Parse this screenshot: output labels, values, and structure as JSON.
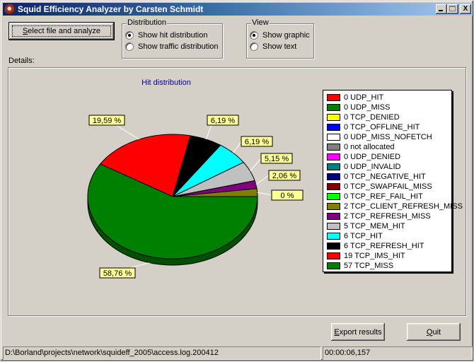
{
  "window": {
    "title": "Squid Efficiency Analyzer by Carsten Schmidt",
    "minimize_label": "_",
    "maximize_label": "□",
    "close_label": "X"
  },
  "toolbar": {
    "select_button": {
      "prefix": "S",
      "rest": "elect file and analyze"
    }
  },
  "distribution": {
    "label": "Distribution",
    "options": [
      {
        "label": "Show hit distribution",
        "checked": true
      },
      {
        "label": "Show traffic distribution",
        "checked": false
      }
    ]
  },
  "view": {
    "label": "View",
    "options": [
      {
        "label": "Show graphic",
        "checked": true
      },
      {
        "label": "Show text",
        "checked": false
      }
    ]
  },
  "details": {
    "label": "Details:"
  },
  "buttons": {
    "export": {
      "prefix": "E",
      "rest": "xport results"
    },
    "quit": {
      "prefix": "Q",
      "rest": "uit"
    }
  },
  "statusbar": {
    "path": "D:\\Borland\\projects\\network\\squideff_2005\\access.log.200412",
    "elapsed": "00:00:06,157"
  },
  "colors": {
    "title_color": "#0000a0",
    "label_bg": "#ffff99"
  },
  "chart_data": {
    "type": "pie",
    "title": "Hit distribution",
    "legend_position": "right",
    "legend": [
      {
        "count": 0,
        "name": "UDP_HIT",
        "color": "#ff0000",
        "text": "0 UDP_HIT"
      },
      {
        "count": 0,
        "name": "UDP_MISS",
        "color": "#008000",
        "text": "0 UDP_MISS"
      },
      {
        "count": 0,
        "name": "TCP_DENIED",
        "color": "#ffff00",
        "text": "0 TCP_DENIED"
      },
      {
        "count": 0,
        "name": "TCP_OFFLINE_HIT",
        "color": "#0000ff",
        "text": "0 TCP_OFFLINE_HIT"
      },
      {
        "count": 0,
        "name": "UDP_MISS_NOFETCH",
        "color": "#ffffff",
        "text": "0 UDP_MISS_NOFETCH"
      },
      {
        "count": 0,
        "name": "not allocated",
        "color": "#808080",
        "text": "0 not allocated"
      },
      {
        "count": 0,
        "name": "UDP_DENIED",
        "color": "#ff00ff",
        "text": "0 UDP_DENIED"
      },
      {
        "count": 0,
        "name": "UDP_INVALID",
        "color": "#008080",
        "text": "0 UDP_INVALID"
      },
      {
        "count": 0,
        "name": "TCP_NEGATIVE_HIT",
        "color": "#000080",
        "text": "0 TCP_NEGATIVE_HIT"
      },
      {
        "count": 0,
        "name": "TCP_SWAPFAIL_MISS",
        "color": "#800000",
        "text": "0 TCP_SWAPFAIL_MISS"
      },
      {
        "count": 0,
        "name": "TCP_REF_FAIL_HIT",
        "color": "#00ff00",
        "text": "0 TCP_REF_FAIL_HIT"
      },
      {
        "count": 2,
        "name": "TCP_CLIENT_REFRESH_MISS",
        "color": "#808000",
        "text": "2 TCP_CLIENT_REFRESH_MISS"
      },
      {
        "count": 2,
        "name": "TCP_REFRESH_MISS",
        "color": "#800080",
        "text": "2 TCP_REFRESH_MISS"
      },
      {
        "count": 5,
        "name": "TCP_MEM_HIT",
        "color": "#c0c0c0",
        "text": "5 TCP_MEM_HIT"
      },
      {
        "count": 6,
        "name": "TCP_HIT",
        "color": "#00ffff",
        "text": "6 TCP_HIT"
      },
      {
        "count": 6,
        "name": "TCP_REFRESH_HIT",
        "color": "#000000",
        "text": "6 TCP_REFRESH_HIT"
      },
      {
        "count": 19,
        "name": "TCP_IMS_HIT",
        "color": "#ff0000",
        "text": "19 TCP_IMS_HIT"
      },
      {
        "count": 57,
        "name": "TCP_MISS",
        "color": "#008000",
        "text": "57 TCP_MISS"
      }
    ],
    "slices": [
      {
        "name": "TCP_CLIENT_REFRESH_MISS",
        "value": 2.06,
        "label": "2,06 %",
        "color": "#808000",
        "side": "#404000"
      },
      {
        "name": "TCP_REFRESH_MISS",
        "value": 2.06,
        "label": "2,06 %",
        "color": "#800080",
        "side": "#400040"
      },
      {
        "name": "TCP_MEM_HIT",
        "value": 5.15,
        "label": "5,15 %",
        "color": "#c0c0c0",
        "side": "#808080"
      },
      {
        "name": "TCP_HIT",
        "value": 6.19,
        "label": "6,19 %",
        "color": "#00ffff",
        "side": "#008080"
      },
      {
        "name": "TCP_REFRESH_HIT",
        "value": 6.19,
        "label": "6,19 %",
        "color": "#000000",
        "side": "#000000"
      },
      {
        "name": "TCP_IMS_HIT",
        "value": 19.59,
        "label": "19,59 %",
        "color": "#ff0000",
        "side": "#800000"
      },
      {
        "name": "TCP_MISS",
        "value": 58.76,
        "label": "58,76 %",
        "color": "#008000",
        "side": "#005000"
      }
    ],
    "hidden_zero_label": "0 %"
  }
}
